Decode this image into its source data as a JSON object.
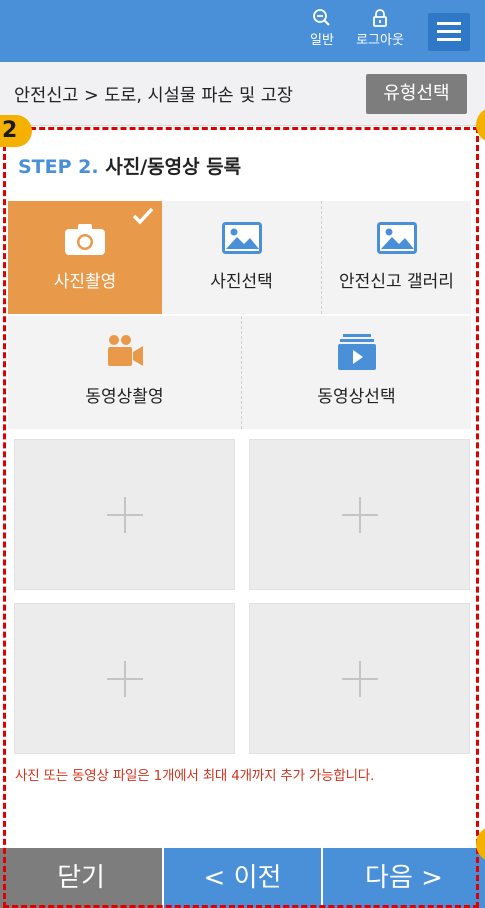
{
  "header": {
    "zoom_label": "일반",
    "logout_label": "로그아웃",
    "menu_icon": "hamburger-menu-icon",
    "accent_color": "#4a90d9"
  },
  "breadcrumb": {
    "text": "안전신고 > 도로, 시설물 파손 및 고장",
    "type_select_label": "유형선택"
  },
  "step": {
    "badge": "2",
    "number_label": "STEP 2.",
    "title": "사진/동영상 등록"
  },
  "media_options": [
    {
      "label": "사진촬영",
      "icon": "camera-icon",
      "selected": true
    },
    {
      "label": "사진선택",
      "icon": "image-icon",
      "selected": false
    },
    {
      "label": "안전신고 갤러리",
      "icon": "image-icon",
      "selected": false
    },
    {
      "label": "동영상촬영",
      "icon": "video-camera-icon",
      "selected": false
    },
    {
      "label": "동영상선택",
      "icon": "video-file-icon",
      "selected": false
    }
  ],
  "upload_slots": [
    {
      "icon": "plus-icon"
    },
    {
      "icon": "plus-icon"
    },
    {
      "icon": "plus-icon"
    },
    {
      "icon": "plus-icon"
    }
  ],
  "notice": "사진 또는 동영상 파일은 1개에서 최대 4개까지 추가 가능합니다.",
  "footer": {
    "close_label": "닫기",
    "prev_label": "< 이전",
    "next_label": "다음 >"
  },
  "colors": {
    "selected": "#e8994a",
    "notice": "#d0341f",
    "highlight_frame": "#e00000",
    "badge": "#f5b100"
  }
}
